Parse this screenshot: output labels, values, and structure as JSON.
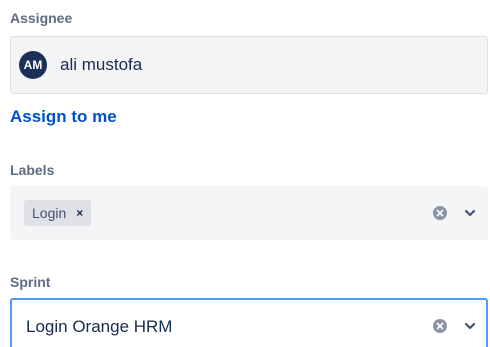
{
  "assignee": {
    "label": "Assignee",
    "avatar_initials": "AM",
    "name": "ali mustofa",
    "assign_to_me": "Assign to me"
  },
  "labels": {
    "label": "Labels",
    "tags": [
      {
        "text": "Login",
        "remove_glyph": "×"
      }
    ]
  },
  "sprint": {
    "label": "Sprint",
    "value": "Login Orange HRM"
  },
  "icons": {
    "clear": "clear-icon",
    "chevron": "chevron-down-icon"
  },
  "colors": {
    "avatar_bg": "#1d2f56",
    "link": "#0052cc",
    "focus_border": "#4c9aff",
    "field_bg": "#f4f5f7"
  }
}
